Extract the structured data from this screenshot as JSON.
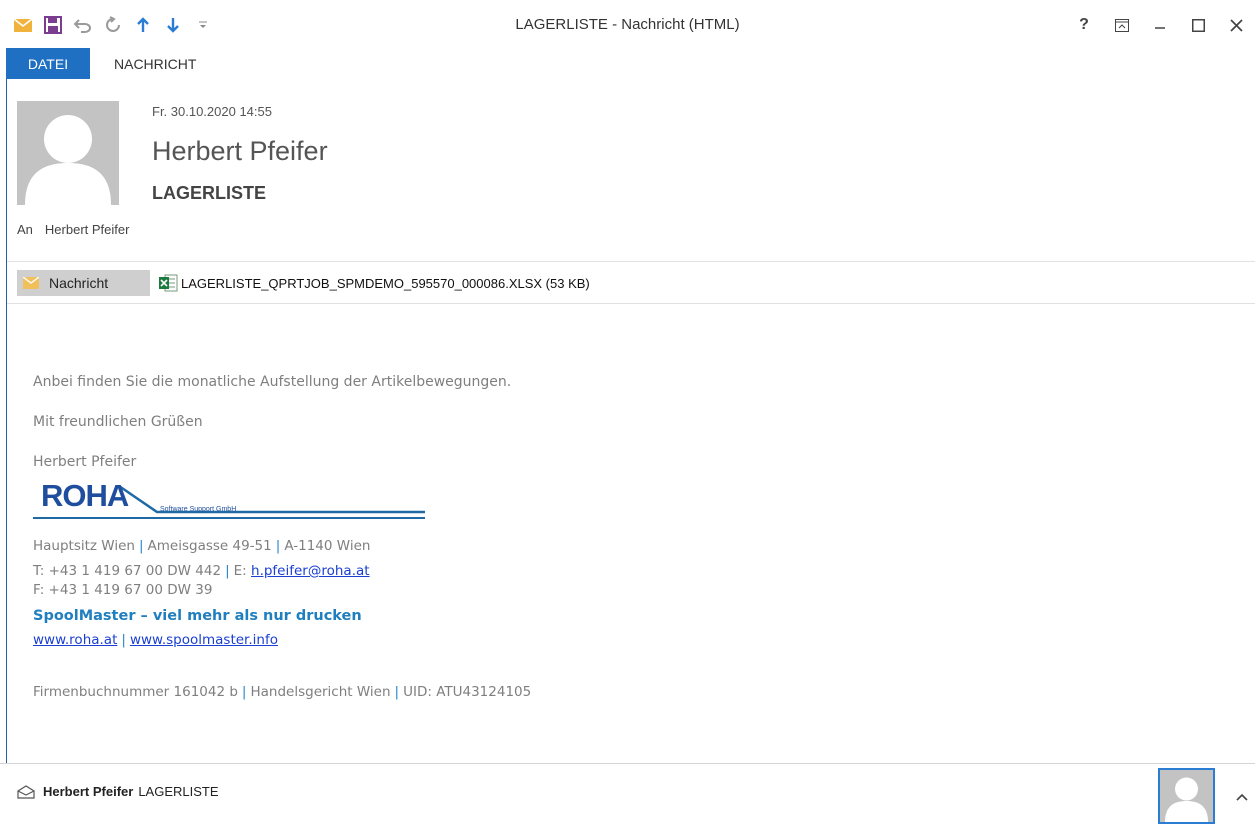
{
  "window": {
    "title": "LAGERLISTE - Nachricht (HTML)",
    "help": "?"
  },
  "ribbon": {
    "tabs": [
      "DATEI",
      "NACHRICHT"
    ]
  },
  "header": {
    "date": "Fr. 30.10.2020 14:55",
    "from": "Herbert Pfeifer",
    "subject": "LAGERLISTE",
    "to_label": "An",
    "to": "Herbert Pfeifer"
  },
  "attachments": {
    "message_button": "Nachricht",
    "file": "LAGERLISTE_QPRTJOB_SPMDEMO_595570_000086.XLSX (53 KB)"
  },
  "body": {
    "intro": "Anbei finden Sie die monatliche Aufstellung der Artikelbewegungen.",
    "greeting": "Mit freundlichen Grüßen",
    "sender_name": "Herbert Pfeifer",
    "logo_text": "ROHA",
    "logo_subtext": "Software Support GmbH",
    "address_parts": [
      "Hauptsitz Wien",
      "Ameisgasse 49-51",
      "A-1140 Wien"
    ],
    "phone": "T: +43 1 419 67 00 DW 442",
    "email_label": "E:",
    "email": "h.pfeifer@roha.at",
    "fax": "F: +43 1 419 67 00 DW 39",
    "slogan": "SpoolMaster – viel mehr als nur drucken",
    "web1": "www.roha.at",
    "web2": "www.spoolmaster.info",
    "company_parts": [
      "Firmenbuchnummer 161042 b",
      "Handelsgericht Wien",
      "UID: ATU43124105"
    ]
  },
  "people_pane": {
    "name": "Herbert Pfeifer",
    "subject": "LAGERLISTE"
  },
  "colors": {
    "accent": "#1f6fc2",
    "slogan": "#1f7fbf",
    "separator": "#2a86c9",
    "link": "#1a3fd1",
    "qat_mail": "#f2b33d",
    "qat_save": "#7a3d8f",
    "qat_nav": "#2b7cd3"
  }
}
